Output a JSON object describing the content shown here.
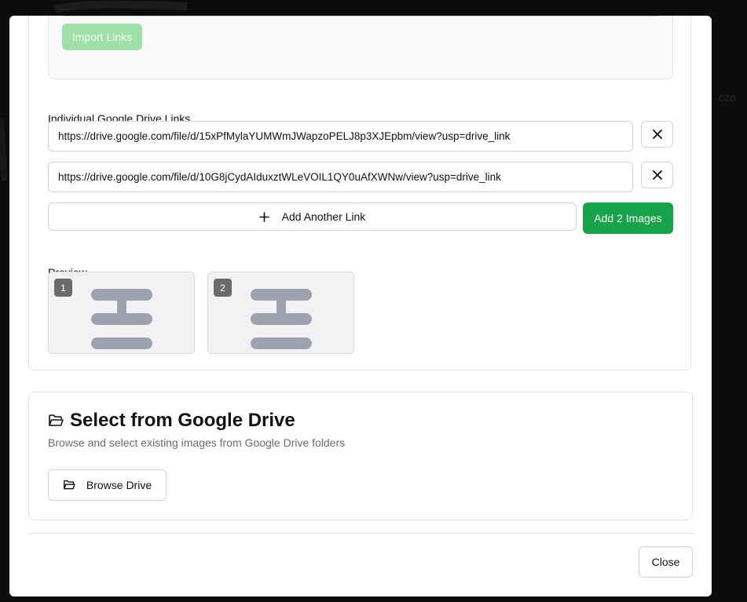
{
  "import": {
    "button_label": "Import Links"
  },
  "individual": {
    "label": "Individual Google Drive Links",
    "links": [
      "https://drive.google.com/file/d/15xPfMylaYUMWmJWapzoPELJ8p3XJEpbm/view?usp=drive_link",
      "https://drive.google.com/file/d/10G8jCydAIduxztWLeVOIL1QY0uAfXWNw/view?usp=drive_link"
    ],
    "add_link_label": "Add Another Link",
    "add_images_label": "Add 2 Images"
  },
  "preview": {
    "label": "Preview",
    "items": [
      "1",
      "2"
    ]
  },
  "drive": {
    "title": "Select from Google Drive",
    "subtitle": "Browse and select existing images from Google Drive folders",
    "browse_label": "Browse Drive"
  },
  "footer": {
    "close_label": "Close"
  },
  "colors": {
    "primary_green": "#16a34a",
    "disabled_green": "#9fdfaa",
    "placeholder_gray": "#9ca3af"
  },
  "icons": {
    "remove": "x-icon",
    "add": "plus-icon",
    "folder": "folder-open-icon",
    "placeholder": "image-placeholder-icon"
  }
}
